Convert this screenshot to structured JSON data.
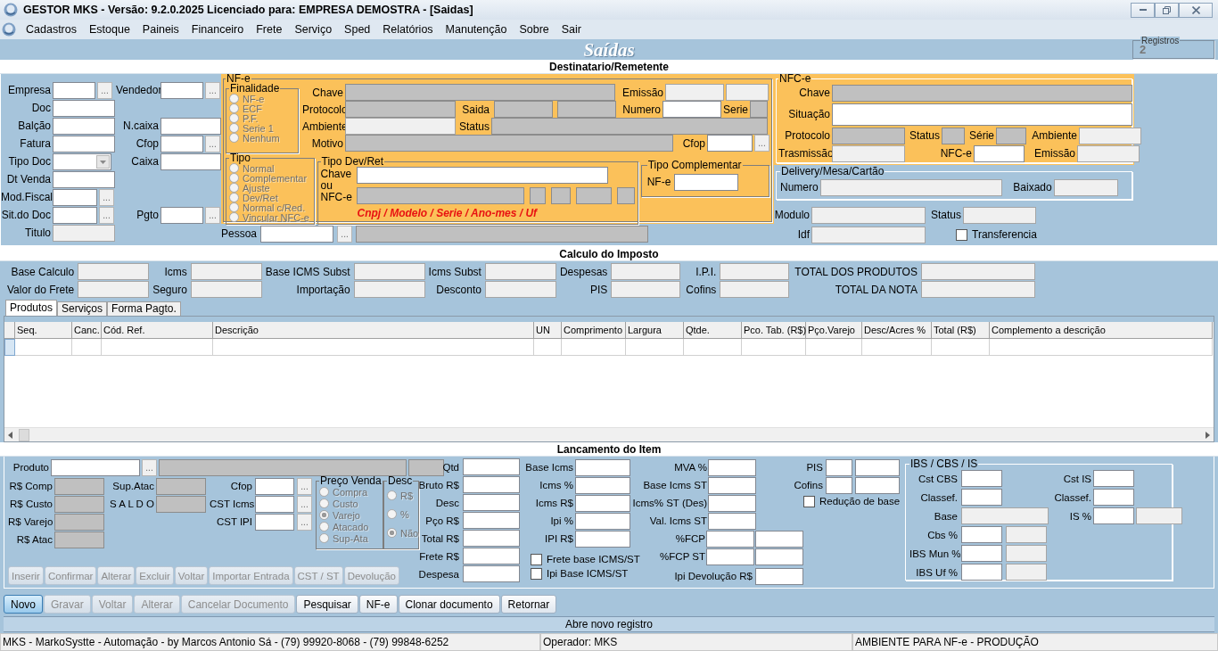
{
  "window": {
    "title": "GESTOR MKS - Versão: 9.2.0.2025 Licenciado para: EMPRESA DEMOSTRA - [Saidas]"
  },
  "menu": [
    "Cadastros",
    "Estoque",
    "Paineis",
    "Financeiro",
    "Frete",
    "Serviço",
    "Sped",
    "Relatórios",
    "Manutenção",
    "Sobre",
    "Sair"
  ],
  "header": {
    "title": "Saídas",
    "registros": {
      "label": "Registros",
      "value": "2"
    }
  },
  "destinatario": {
    "heading": "Destinatario/Remetente",
    "left": [
      {
        "label": "Empresa",
        "parts": [
          {
            "kind": "edit"
          },
          {
            "kind": "button",
            "label": "..."
          }
        ]
      },
      {
        "label": "Doc",
        "parts": [
          {
            "kind": "edit"
          }
        ]
      },
      {
        "label": "Balção",
        "parts": [
          {
            "kind": "edit"
          }
        ]
      },
      {
        "label": "Fatura",
        "parts": [
          {
            "kind": "edit"
          }
        ]
      },
      {
        "label": "Tipo Doc",
        "parts": [
          {
            "kind": "combo"
          }
        ]
      },
      {
        "label": "Dt Venda",
        "parts": [
          {
            "kind": "edit"
          }
        ]
      },
      {
        "label": "Mod.Fiscal",
        "parts": [
          {
            "kind": "edit"
          },
          {
            "kind": "button",
            "label": "..."
          }
        ]
      },
      {
        "label": "Sit.do Doc",
        "parts": [
          {
            "kind": "edit"
          },
          {
            "kind": "button",
            "label": "..."
          }
        ]
      },
      {
        "label": "Titulo",
        "parts": [
          {
            "kind": "off"
          }
        ]
      }
    ],
    "left_b": [
      {
        "label": "Vendedor",
        "parts": [
          {
            "kind": "edit"
          },
          {
            "kind": "button",
            "label": "..."
          }
        ]
      },
      {
        "label": "N.caixa",
        "parts": [
          {
            "kind": "edit"
          }
        ]
      },
      {
        "label": "Cfop",
        "parts": [
          {
            "kind": "edit"
          },
          {
            "kind": "button",
            "label": "..."
          }
        ]
      },
      {
        "label": "Caixa",
        "parts": [
          {
            "kind": "edit"
          }
        ]
      },
      {
        "label": "Pgto",
        "parts": [
          {
            "kind": "edit"
          },
          {
            "kind": "button",
            "label": "..."
          }
        ]
      }
    ],
    "nfe": {
      "legend": "NF-e",
      "finalidade": {
        "legend": "Finalidade",
        "disabled": true,
        "options": [
          {
            "label": "NF-e",
            "selected": false
          },
          {
            "label": "ECF",
            "selected": false
          },
          {
            "label": "P.F.",
            "selected": false
          },
          {
            "label": "Serie 1",
            "selected": false
          },
          {
            "label": "Nenhum",
            "selected": false
          }
        ]
      },
      "tipo": {
        "legend": "Tipo",
        "disabled": true,
        "options": [
          {
            "label": "Normal",
            "selected": false
          },
          {
            "label": "Complementar",
            "selected": false
          },
          {
            "label": "Ajuste",
            "selected": false
          },
          {
            "label": "Dev/Ret",
            "selected": false
          },
          {
            "label": "Normal c/Red.",
            "selected": false
          },
          {
            "label": "Vincular NFC-e",
            "selected": false
          }
        ]
      },
      "fields": [
        {
          "label": "Chave",
          "parts": [
            {
              "kind": "locked"
            }
          ]
        },
        {
          "label": "Emissão",
          "parts": [
            {
              "kind": "off"
            },
            {
              "kind": "off"
            }
          ]
        },
        {
          "label": "Protocolo",
          "parts": [
            {
              "kind": "locked"
            }
          ]
        },
        {
          "label": "Saida",
          "parts": [
            {
              "kind": "locked"
            },
            {
              "kind": "locked"
            }
          ]
        },
        {
          "label": "Numero",
          "parts": [
            {
              "kind": "edit"
            }
          ]
        },
        {
          "label": "Serie",
          "parts": [
            {
              "kind": "locked"
            }
          ]
        },
        {
          "label": "Ambiente",
          "parts": [
            {
              "kind": "off"
            }
          ]
        },
        {
          "label": "Status",
          "parts": [
            {
              "kind": "locked"
            }
          ]
        },
        {
          "label": "Motivo",
          "parts": [
            {
              "kind": "locked"
            }
          ]
        },
        {
          "label": "Cfop",
          "parts": [
            {
              "kind": "edit"
            },
            {
              "kind": "button",
              "label": "..."
            }
          ]
        }
      ],
      "dev_ret": {
        "legend": "Tipo Dev/Ret",
        "label": "Chave ou NFC-e",
        "parts": [
          {
            "kind": "edit"
          }
        ],
        "key_parts": [
          {
            "kind": "locked"
          },
          {
            "kind": "locked"
          },
          {
            "kind": "locked"
          },
          {
            "kind": "locked"
          },
          {
            "kind": "locked"
          }
        ],
        "hint": "Cnpj / Modelo / Serie / Ano-mes / Uf"
      },
      "complementar": {
        "legend": "Tipo Complementar",
        "fields": [
          {
            "label": "NF-e",
            "parts": [
              {
                "kind": "edit"
              }
            ]
          }
        ]
      }
    },
    "pessoa": {
      "label": "Pessoa",
      "parts": [
        {
          "kind": "edit"
        },
        {
          "kind": "button",
          "label": "..."
        },
        {
          "kind": "locked"
        }
      ]
    },
    "nfce": {
      "legend": "NFC-e",
      "fields": [
        {
          "label": "Chave",
          "parts": [
            {
              "kind": "locked"
            }
          ]
        },
        {
          "label": "Situação",
          "parts": [
            {
              "kind": "edit"
            }
          ]
        },
        {
          "label": "Protocolo",
          "parts": [
            {
              "kind": "locked"
            }
          ]
        },
        {
          "label": "Status",
          "parts": [
            {
              "kind": "locked"
            }
          ]
        },
        {
          "label": "Série",
          "parts": [
            {
              "kind": "locked"
            }
          ]
        },
        {
          "label": "Ambiente",
          "parts": [
            {
              "kind": "off"
            }
          ]
        },
        {
          "label": "Trasmissão",
          "parts": [
            {
              "kind": "off"
            }
          ]
        },
        {
          "label": "NFC-e",
          "parts": [
            {
              "kind": "edit"
            }
          ]
        },
        {
          "label": "Emissão",
          "parts": [
            {
              "kind": "off"
            }
          ]
        }
      ]
    },
    "delivery": {
      "legend": "Delivery/Mesa/Cartão",
      "fields": [
        {
          "label": "Numero",
          "parts": [
            {
              "kind": "off"
            }
          ]
        },
        {
          "label": "Baixado",
          "parts": [
            {
              "kind": "off"
            }
          ]
        }
      ]
    },
    "extra": [
      {
        "label": "Modulo",
        "parts": [
          {
            "kind": "off"
          }
        ]
      },
      {
        "label": "Status",
        "parts": [
          {
            "kind": "off"
          }
        ]
      },
      {
        "label": "Idf",
        "parts": [
          {
            "kind": "off"
          }
        ]
      }
    ],
    "transferencia": {
      "label": "Transferencia",
      "checked": false
    }
  },
  "imposto": {
    "heading": "Calculo do Imposto",
    "fields": [
      {
        "label": "Base Calculo",
        "parts": [
          {
            "kind": "off"
          }
        ]
      },
      {
        "label": "Icms",
        "parts": [
          {
            "kind": "off"
          }
        ]
      },
      {
        "label": "Base ICMS Subst",
        "parts": [
          {
            "kind": "off"
          }
        ]
      },
      {
        "label": "Icms Subst",
        "parts": [
          {
            "kind": "off"
          }
        ]
      },
      {
        "label": "Despesas",
        "parts": [
          {
            "kind": "off"
          }
        ]
      },
      {
        "label": "I.P.I.",
        "parts": [
          {
            "kind": "off"
          }
        ]
      },
      {
        "label": "TOTAL DOS PRODUTOS",
        "parts": [
          {
            "kind": "off"
          }
        ]
      },
      {
        "label": "Valor do Frete",
        "parts": [
          {
            "kind": "off"
          }
        ]
      },
      {
        "label": "Seguro",
        "parts": [
          {
            "kind": "off"
          }
        ]
      },
      {
        "label": "Importação",
        "parts": [
          {
            "kind": "off"
          }
        ]
      },
      {
        "label": "Desconto",
        "parts": [
          {
            "kind": "off"
          }
        ]
      },
      {
        "label": "PIS",
        "parts": [
          {
            "kind": "off"
          }
        ]
      },
      {
        "label": "Cofins",
        "parts": [
          {
            "kind": "off"
          }
        ]
      },
      {
        "label": "TOTAL DA NOTA",
        "parts": [
          {
            "kind": "off"
          }
        ]
      }
    ]
  },
  "tabs": [
    {
      "label": "Produtos",
      "selected": true
    },
    {
      "label": "Serviços",
      "selected": false
    },
    {
      "label": "Forma Pagto.",
      "selected": false
    }
  ],
  "table": {
    "columns": [
      "Seq.",
      "Canc.",
      "Cód. Ref.",
      "Descrição",
      "UN",
      "Comprimento",
      "Largura",
      "Qtde.",
      "Pco. Tab. (R$)",
      "Pço.Varejo",
      "Desc/Acres %",
      "Total (R$)",
      "Complemento a descrição"
    ]
  },
  "item": {
    "heading": "Lancamento do Item",
    "produto": {
      "label": "Produto",
      "parts": [
        {
          "kind": "edit"
        },
        {
          "kind": "button",
          "label": "..."
        },
        {
          "kind": "locked"
        },
        {
          "kind": "locked"
        }
      ]
    },
    "precos": [
      {
        "label": "R$ Comp",
        "parts": [
          {
            "kind": "locked"
          }
        ]
      },
      {
        "label": "R$ Custo",
        "parts": [
          {
            "kind": "locked"
          }
        ]
      },
      {
        "label": "R$ Varejo",
        "parts": [
          {
            "kind": "locked"
          }
        ]
      },
      {
        "label": "R$ Atac",
        "parts": [
          {
            "kind": "locked"
          }
        ]
      }
    ],
    "saldo": [
      {
        "label": "Sup.Atac",
        "parts": [
          {
            "kind": "locked"
          }
        ]
      },
      {
        "label": "S A L D O",
        "parts": [
          {
            "kind": "locked"
          }
        ]
      }
    ],
    "cst": [
      {
        "label": "Cfop",
        "parts": [
          {
            "kind": "edit"
          },
          {
            "kind": "button",
            "label": "..."
          }
        ]
      },
      {
        "label": "CST Icms",
        "parts": [
          {
            "kind": "edit"
          },
          {
            "kind": "button",
            "label": "..."
          }
        ]
      },
      {
        "label": "CST IPI",
        "parts": [
          {
            "kind": "edit"
          },
          {
            "kind": "button",
            "label": "..."
          }
        ]
      }
    ],
    "preco_venda": {
      "legend": "Preço Venda",
      "disabled": true,
      "options": [
        {
          "label": "Compra",
          "selected": false
        },
        {
          "label": "Custo",
          "selected": false
        },
        {
          "label": "Varejo",
          "selected": true
        },
        {
          "label": "Atacado",
          "selected": false
        },
        {
          "label": "Sup-Ata",
          "selected": false
        }
      ]
    },
    "desc": {
      "legend": "Desc",
      "disabled": true,
      "options": [
        {
          "label": "R$",
          "selected": false
        },
        {
          "label": "%",
          "selected": false
        },
        {
          "label": "Não",
          "selected": true
        }
      ]
    },
    "valores": [
      {
        "label": "Qtd",
        "parts": [
          {
            "kind": "edit"
          }
        ]
      },
      {
        "label": "Bruto R$",
        "parts": [
          {
            "kind": "edit"
          }
        ]
      },
      {
        "label": "Desc",
        "parts": [
          {
            "kind": "edit"
          }
        ]
      },
      {
        "label": "Pço R$",
        "parts": [
          {
            "kind": "edit"
          }
        ]
      },
      {
        "label": "Total R$",
        "parts": [
          {
            "kind": "edit"
          }
        ]
      },
      {
        "label": "Frete R$",
        "parts": [
          {
            "kind": "edit"
          }
        ]
      },
      {
        "label": "Despesa",
        "parts": [
          {
            "kind": "edit"
          }
        ]
      }
    ],
    "icms": [
      {
        "label": "Base Icms",
        "parts": [
          {
            "kind": "edit"
          }
        ]
      },
      {
        "label": "Icms %",
        "parts": [
          {
            "kind": "edit"
          }
        ]
      },
      {
        "label": "Icms R$",
        "parts": [
          {
            "kind": "edit"
          }
        ]
      },
      {
        "label": "Ipi %",
        "parts": [
          {
            "kind": "edit"
          }
        ]
      },
      {
        "label": "IPI R$",
        "parts": [
          {
            "kind": "edit"
          }
        ]
      }
    ],
    "icms_checks": [
      {
        "label": "Frete base ICMS/ST",
        "checked": false
      },
      {
        "label": "Ipi Base ICMS/ST",
        "checked": false
      }
    ],
    "st": [
      {
        "label": "MVA %",
        "parts": [
          {
            "kind": "edit"
          }
        ]
      },
      {
        "label": "Base Icms ST",
        "parts": [
          {
            "kind": "edit"
          }
        ]
      },
      {
        "label": "Icms% ST (Des)",
        "parts": [
          {
            "kind": "edit"
          }
        ]
      },
      {
        "label": "Val. Icms ST",
        "parts": [
          {
            "kind": "edit"
          }
        ]
      },
      {
        "label": "%FCP",
        "parts": [
          {
            "kind": "edit"
          },
          {
            "kind": "edit"
          }
        ]
      },
      {
        "label": "%FCP ST",
        "parts": [
          {
            "kind": "edit"
          },
          {
            "kind": "edit"
          }
        ]
      },
      {
        "label": "Ipi Devolução R$",
        "parts": [
          {
            "kind": "edit"
          }
        ]
      }
    ],
    "pis": [
      {
        "label": "PIS",
        "parts": [
          {
            "kind": "edit"
          },
          {
            "kind": "edit"
          }
        ]
      },
      {
        "label": "Cofins",
        "parts": [
          {
            "kind": "edit"
          },
          {
            "kind": "edit"
          }
        ]
      }
    ],
    "reducao": {
      "label": "Redução de base",
      "checked": false
    },
    "ibs": {
      "legend": "IBS / CBS / IS",
      "left": [
        {
          "label": "Cst CBS",
          "parts": [
            {
              "kind": "edit"
            }
          ]
        },
        {
          "label": "Classef.",
          "parts": [
            {
              "kind": "edit"
            }
          ]
        },
        {
          "label": "Base",
          "parts": [
            {
              "kind": "off"
            }
          ]
        },
        {
          "label": "Cbs %",
          "parts": [
            {
              "kind": "edit"
            },
            {
              "kind": "off"
            }
          ]
        },
        {
          "label": "IBS Mun %",
          "parts": [
            {
              "kind": "edit"
            },
            {
              "kind": "off"
            }
          ]
        },
        {
          "label": "IBS Uf %",
          "parts": [
            {
              "kind": "edit"
            },
            {
              "kind": "off"
            }
          ]
        }
      ],
      "right": [
        {
          "label": "Cst IS",
          "parts": [
            {
              "kind": "edit"
            }
          ]
        },
        {
          "label": "Classef.",
          "parts": [
            {
              "kind": "edit"
            }
          ]
        },
        {
          "label": "IS %",
          "parts": [
            {
              "kind": "edit"
            },
            {
              "kind": "off"
            }
          ]
        }
      ]
    },
    "actions": [
      {
        "label": "Inserir",
        "disabled": true
      },
      {
        "label": "Confirmar",
        "disabled": true
      },
      {
        "label": "Alterar",
        "disabled": true
      },
      {
        "label": "Excluir",
        "disabled": true
      },
      {
        "label": "Voltar",
        "disabled": true
      },
      {
        "label": "Importar Entrada",
        "disabled": true
      },
      {
        "label": "CST / ST",
        "disabled": true
      },
      {
        "label": "Devolução",
        "disabled": true
      }
    ]
  },
  "buttons": [
    {
      "label": "Novo",
      "disabled": false,
      "focused": true
    },
    {
      "label": "Gravar",
      "disabled": true,
      "focused": false
    },
    {
      "label": "Voltar",
      "disabled": true,
      "focused": false
    },
    {
      "label": "Alterar",
      "disabled": true,
      "focused": false
    },
    {
      "label": "Cancelar Documento",
      "disabled": true,
      "focused": false
    },
    {
      "label": "Pesquisar",
      "disabled": false,
      "focused": false
    },
    {
      "label": "NF-e",
      "disabled": false,
      "focused": false
    },
    {
      "label": "Clonar documento",
      "disabled": false,
      "focused": false
    },
    {
      "label": "Retornar",
      "disabled": false,
      "focused": false
    }
  ],
  "message": "Abre novo registro",
  "status_bar": [
    "MKS - MarkoSystte - Automação - by Marcos Antonio Sá - (79) 99920-8068 - (79) 99848-6252",
    "Operador: MKS",
    "AMBIENTE PARA NF-e - PRODUÇÃO"
  ]
}
